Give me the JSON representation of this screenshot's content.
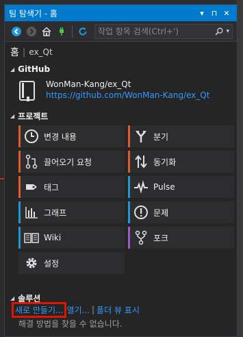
{
  "window": {
    "title": "팀 탐색기 - 홈",
    "buttons": [
      "▾",
      "⊓",
      "✕"
    ]
  },
  "toolbar": {
    "search_placeholder": "작업 항목 검색(Ctrl+')"
  },
  "breadcrumb": {
    "home": "홈",
    "separator": "|",
    "repo": "ex_Qt"
  },
  "github_section": {
    "header": "GitHub",
    "repo_name": "WonMan-Kang/ex_Qt",
    "repo_url": "https://github.com/WonMan-Kang/ex_Qt"
  },
  "project_section": {
    "header": "프로젝트",
    "tiles": [
      {
        "label": "변경 내용",
        "icon": "clock-icon",
        "accent": "#e05a2b"
      },
      {
        "label": "분기",
        "icon": "branch-icon",
        "accent": "#e05a2b"
      },
      {
        "label": "끌어오기 요청",
        "icon": "pull-request-icon",
        "accent": "#e05a2b"
      },
      {
        "label": "동기화",
        "icon": "sync-icon",
        "accent": "#e05a2b"
      },
      {
        "label": "태그",
        "icon": "tag-icon",
        "accent": "#e05a2b"
      },
      {
        "label": "Pulse",
        "icon": "pulse-icon",
        "accent": "#1e9ad6"
      },
      {
        "label": "그래프",
        "icon": "graph-icon",
        "accent": "#1e9ad6"
      },
      {
        "label": "문제",
        "icon": "issue-icon",
        "accent": "#1e9ad6"
      },
      {
        "label": "Wiki",
        "icon": "wiki-icon",
        "accent": "#1e9ad6"
      },
      {
        "label": "포크",
        "icon": "fork-icon",
        "accent": "#a05ac8"
      },
      {
        "label": "설정",
        "icon": "gear-icon",
        "accent": ""
      }
    ]
  },
  "solution_section": {
    "header": "솔루션",
    "new_label": "새로 만들기...",
    "open_label": "열기...",
    "folder_view_label": "폴더 뷰 표시",
    "divider": "|",
    "note": "해결 방법을 찾을 수 없습니다."
  }
}
